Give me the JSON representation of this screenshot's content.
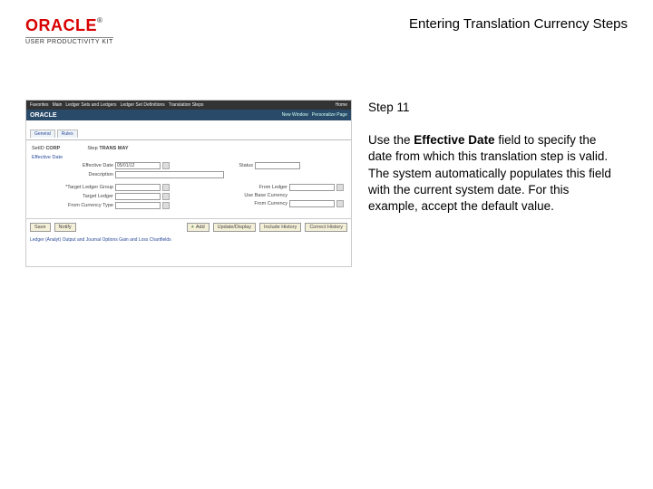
{
  "header": {
    "logo_text": "ORACLE",
    "tm": "®",
    "upk": "USER PRODUCTIVITY KIT",
    "title": "Entering Translation Currency Steps"
  },
  "step": {
    "label": "Step 11",
    "instruction_pre": "Use the ",
    "instruction_bold": "Effective Date",
    "instruction_post": " field to specify the date from which this translation step is valid. The system automatically populates this field with the current system date. For this example, accept the default value."
  },
  "screenshot": {
    "topbar": [
      "Favorites",
      "Main",
      "Ledger Sets and Ledgers",
      "Ledger Set Definitions",
      "Translation Steps"
    ],
    "home": "Home",
    "brand": "ORACLE",
    "quicklinks": [
      "New Window",
      "Personalize Page"
    ],
    "tabs": [
      "General",
      "Rules"
    ],
    "setid_label": "SetID",
    "setid_value": "CORP",
    "step_label": "Step",
    "step_value": "TRANS MAY",
    "section": "Effective Date",
    "eff_label": "Effective Date",
    "eff_value": "05/01/12",
    "status_label": "Status",
    "desc_label": "Description",
    "grid_labels": {
      "target_group": "*Target Ledger Group",
      "target_ledger": "Target Ledger",
      "from_curr_type": "From Currency Type",
      "from_ledger": "From Ledger",
      "base_curr": "Use Base Currency",
      "from_curr": "From Currency"
    },
    "buttons": {
      "save": "Save",
      "notify": "Notify",
      "add": "Add",
      "update": "Update/Display",
      "include": "Include History",
      "correct": "Correct History"
    },
    "footer": "Ledger (Analyt) Output and Journal Options  Gain and Loss Chartfields"
  }
}
